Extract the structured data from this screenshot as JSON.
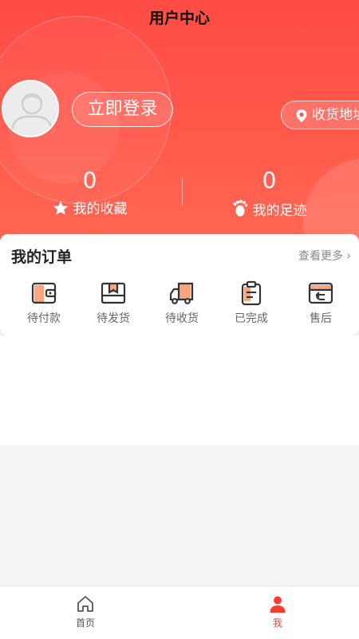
{
  "page": {
    "title": "用户中心"
  },
  "user": {
    "login_label": "立即登录",
    "address_label": "收货地址"
  },
  "stats": [
    {
      "count": "0",
      "label": "我的收藏",
      "icon": "star-icon"
    },
    {
      "count": "0",
      "label": "我的足迹",
      "icon": "footprint-icon"
    }
  ],
  "orders": {
    "title": "我的订单",
    "more_label": "查看更多",
    "items": [
      {
        "label": "待付款",
        "icon": "wallet-icon"
      },
      {
        "label": "待发货",
        "icon": "package-icon"
      },
      {
        "label": "待收货",
        "icon": "truck-icon"
      },
      {
        "label": "已完成",
        "icon": "clipboard-icon"
      },
      {
        "label": "售后",
        "icon": "return-card-icon"
      }
    ]
  },
  "tabbar": [
    {
      "label": "首页",
      "icon": "home-icon",
      "active": false
    },
    {
      "label": "我",
      "icon": "user-icon",
      "active": true
    }
  ],
  "colors": {
    "primary": "#ff4c45",
    "accent_orange": "#f7a77f",
    "active_tab": "#ff3b30"
  }
}
